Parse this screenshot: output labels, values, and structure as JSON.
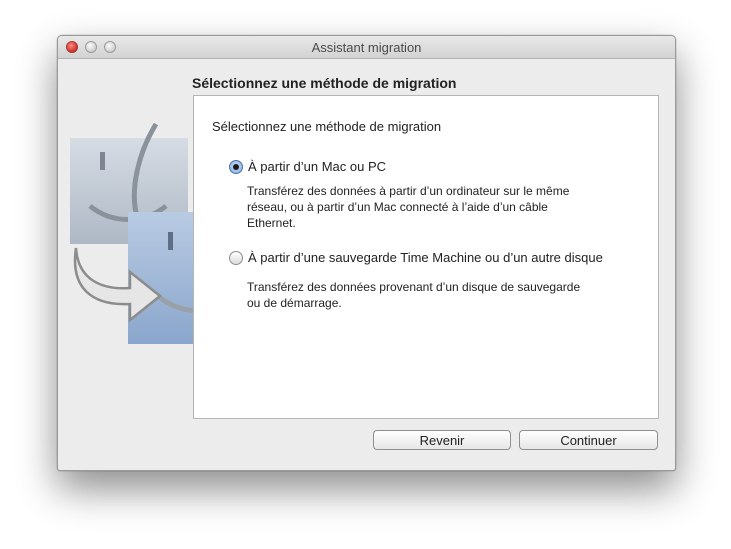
{
  "window": {
    "title": "Assistant migration"
  },
  "page": {
    "heading": "Sélectionnez une méthode de migration",
    "panel_title": "Sélectionnez une méthode de migration"
  },
  "options": [
    {
      "label": "À partir d’un Mac ou PC",
      "description_lines": [
        "Transférez des données à partir d’un ordinateur sur le même",
        "réseau, ou à partir d’un Mac connecté à l’aide d’un câble",
        "Ethernet."
      ],
      "selected": true
    },
    {
      "label": "À partir d’une sauvegarde Time Machine ou d’un autre disque",
      "description_lines": [
        "Transférez des données provenant d’un disque de sauvegarde",
        "ou de démarrage."
      ],
      "selected": false
    }
  ],
  "buttons": {
    "back": "Revenir",
    "continue": "Continuer"
  },
  "icons": {
    "close": "close-button-icon",
    "minimize": "minimize-button-icon",
    "zoom": "zoom-button-icon",
    "art": "finder-migration-icon"
  },
  "colors": {
    "window_bg": "#ececec",
    "close": "#d8362c",
    "radio_selected": "#8fb5e2"
  }
}
